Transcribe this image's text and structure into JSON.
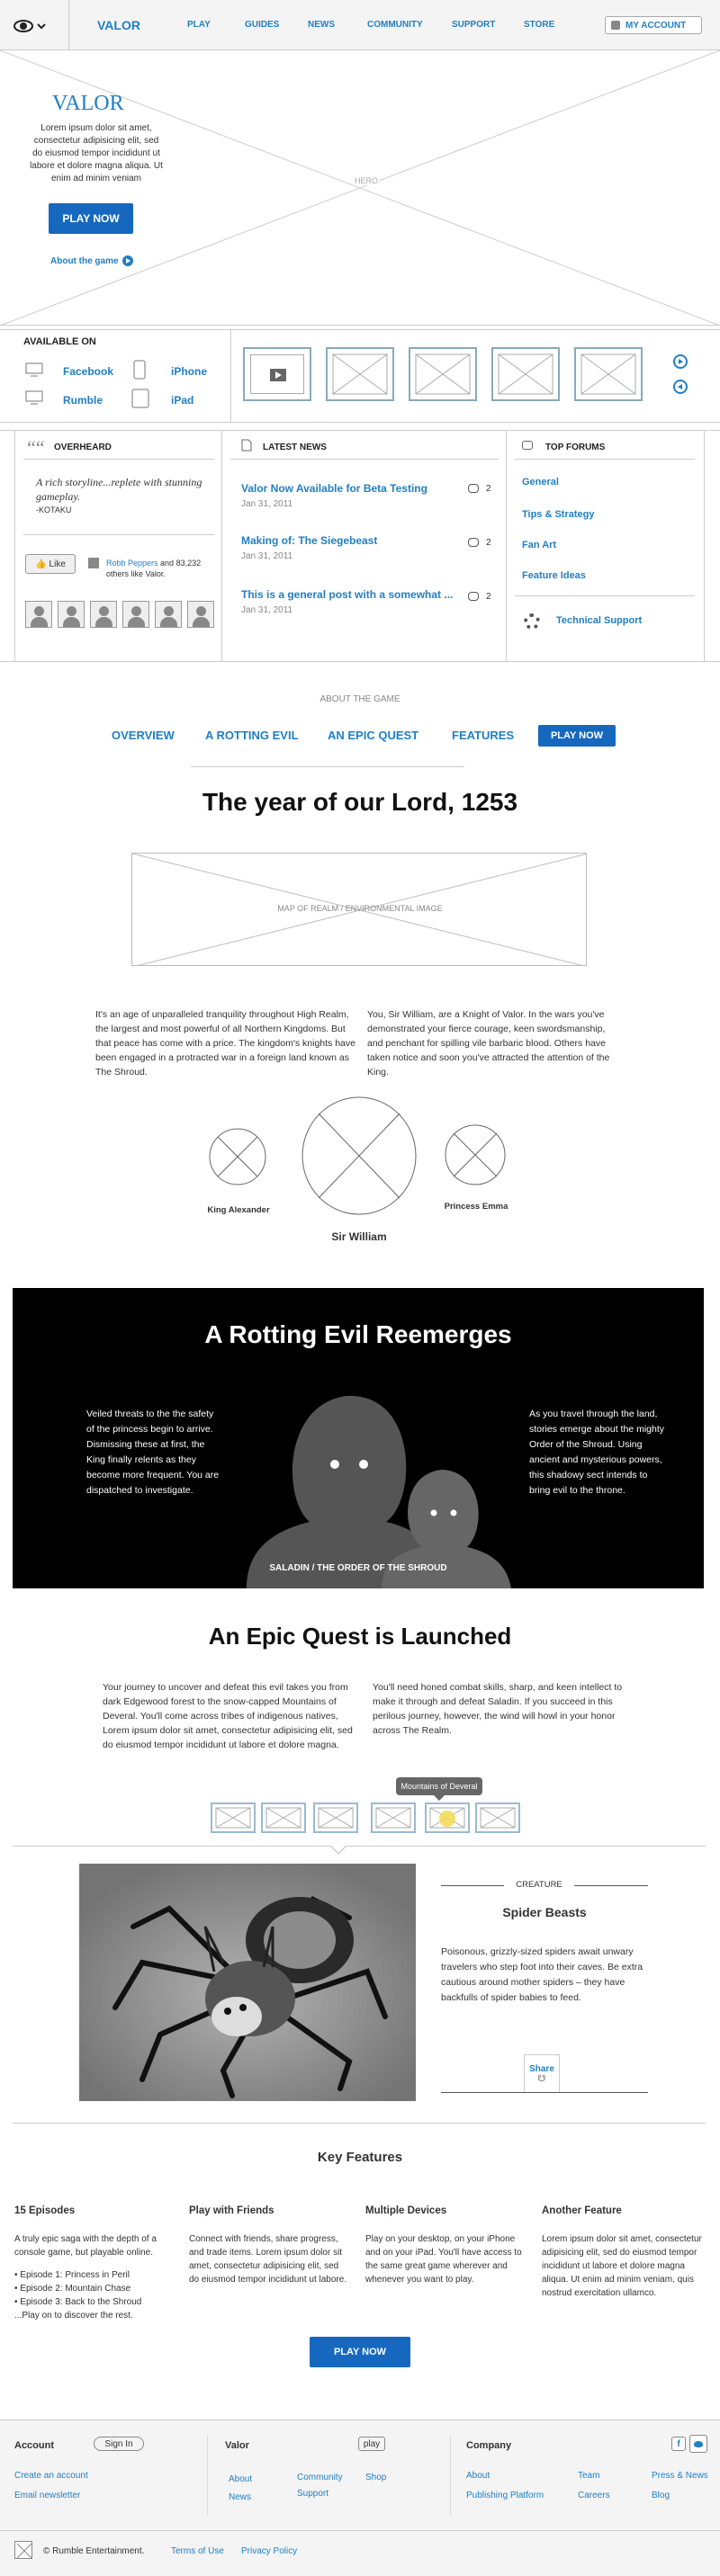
{
  "nav": {
    "items": [
      "VALOR",
      "PLAY",
      "GUIDES",
      "NEWS",
      "COMMUNITY",
      "SUPPORT",
      "STORE"
    ],
    "account": "MY ACCOUNT"
  },
  "hero": {
    "title": "VALOR",
    "text": "Lorem ipsum dolor sit amet, consectetur adipisicing elit, sed do eiusmod tempor incididunt ut labore et dolore magna aliqua. Ut enim ad minim veniam",
    "play": "PLAY NOW",
    "about": "About the game",
    "placeholder": "HERO"
  },
  "available": {
    "heading": "AVAILABLE ON",
    "platforms": [
      "Facebook",
      "iPhone",
      "Rumble",
      "iPad"
    ]
  },
  "overheard": {
    "heading": "OVERHEARD",
    "quote": "A rich storyline...replete with stunning gameplay.",
    "source": "-KOTAKU",
    "like": "Like",
    "friends_link": "Robb Peppers",
    "friends_text": " and 83,232 others like Valor."
  },
  "news": {
    "heading": "LATEST NEWS",
    "items": [
      {
        "title": "Valor Now Available for Beta Testing",
        "date": "Jan 31, 2011",
        "count": "2"
      },
      {
        "title": "Making of: The Siegebeast",
        "date": "Jan 31, 2011",
        "count": "2"
      },
      {
        "title": "This is a general post with a somewhat ...",
        "date": "Jan 31, 2011",
        "count": "2"
      }
    ]
  },
  "forums": {
    "heading": "TOP FORUMS",
    "items": [
      "General",
      "Tips & Strategy",
      "Fan Art",
      "Feature Ideas"
    ],
    "support": "Technical Support"
  },
  "about": {
    "label": "ABOUT THE GAME",
    "tabs": [
      "OVERVIEW",
      "A ROTTING EVIL",
      "AN EPIC QUEST",
      "FEATURES"
    ],
    "play": "PLAY NOW"
  },
  "lord": {
    "title": "The year of our Lord, 1253",
    "map": "MAP OF REALM / ENVIRONMENTAL IMAGE",
    "col1": "It's an age of unparalleled tranquility throughout High Realm, the largest and most powerful of all Northern Kingdoms. But that peace has come with a price. The kingdom's knights have been engaged in a protracted war in a foreign land known as The Shroud.",
    "col2": "You, Sir William, are a Knight of Valor. In the wars you've demonstrated your fierce courage, keen swordsmanship, and penchant for spilling vile barbaric blood. Others have taken notice and soon you've attracted the attention of the King.",
    "chars": [
      "King Alexander",
      "Sir William",
      "Princess Emma"
    ]
  },
  "evil": {
    "title": "A Rotting Evil Reemerges",
    "left": "Veiled threats to the the safety of the princess begin to arrive. Dismissing these at first, the King finally relents as they become more frequent. You are dispatched to investigate.",
    "right": "As you travel through the land, stories emerge about the mighty Order of the Shroud. Using ancient and mysterious powers, this shadowy sect intends to bring evil to the throne.",
    "caption": "SALADIN / THE ORDER OF THE SHROUD"
  },
  "quest": {
    "title": "An Epic Quest is Launched",
    "col1": "Your journey to uncover and defeat this evil takes you from dark Edgewood forest to the snow-capped Mountains of Deveral. You'll come across tribes of indigenous natives, Lorem ipsum dolor sit amet, consectetur adipisicing elit, sed do eiusmod tempor incididunt ut labore et dolore magna.",
    "col2": "You'll need honed combat skills, sharp, and keen intellect to make it through and defeat Saladin. If you succeed in this perilous journey, however, the wind will howl in your honor across The Realm.",
    "tooltip": "Mountains of Deveral",
    "creature_label": "CREATURE",
    "creature_name": "Spider Beasts",
    "creature_text": "Poisonous, grizzly-sized spiders await unwary travelers who step foot into their caves. Be extra cautious around mother spiders – they have backfulls of spider babies to feed.",
    "share": "Share"
  },
  "features": {
    "title": "Key Features",
    "items": [
      {
        "title": "15 Episodes",
        "text": "A truly epic saga with the depth of a console game, but playable online.",
        "list": [
          "• Episode 1: Princess in Peril",
          "• Episode 2: Mountain Chase",
          "• Episode 3: Back to the Shroud",
          "...Play on to discover the rest."
        ]
      },
      {
        "title": "Play with Friends",
        "text": "Connect with friends, share progress, and trade items. Lorem ipsum dolor sit amet, consectetur adipisicing elit, sed do eiusmod tempor incididunt ut labore.",
        "list": []
      },
      {
        "title": "Multiple Devices",
        "text": "Play on your desktop, on your iPhone and on your iPad. You'll have access to the same great game wherever and whenever you want to play.",
        "list": []
      },
      {
        "title": "Another Feature",
        "text": "Lorem ipsum dolor sit amet, consectetur adipisicing elit, sed do eiusmod tempor incididunt ut labore et dolore magna aliqua. Ut enim ad minim veniam, quis nostrud exercitation ullamco.",
        "list": []
      }
    ],
    "play": "PLAY NOW"
  },
  "footer": {
    "account": {
      "heading": "Account",
      "signin": "Sign In",
      "links": [
        "Create an account",
        "Email newsletter"
      ]
    },
    "valor": {
      "heading": "Valor",
      "play": "play",
      "links": [
        "About",
        "News",
        "Community",
        "Support",
        "Shop"
      ]
    },
    "company": {
      "heading": "Company",
      "links": [
        "About",
        "Publishing Platform",
        "Team",
        "Careers",
        "Press & News",
        "Blog"
      ]
    },
    "copyright": "© Rumble Entertainment.",
    "terms": "Terms of Use",
    "privacy": "Privacy Policy"
  }
}
